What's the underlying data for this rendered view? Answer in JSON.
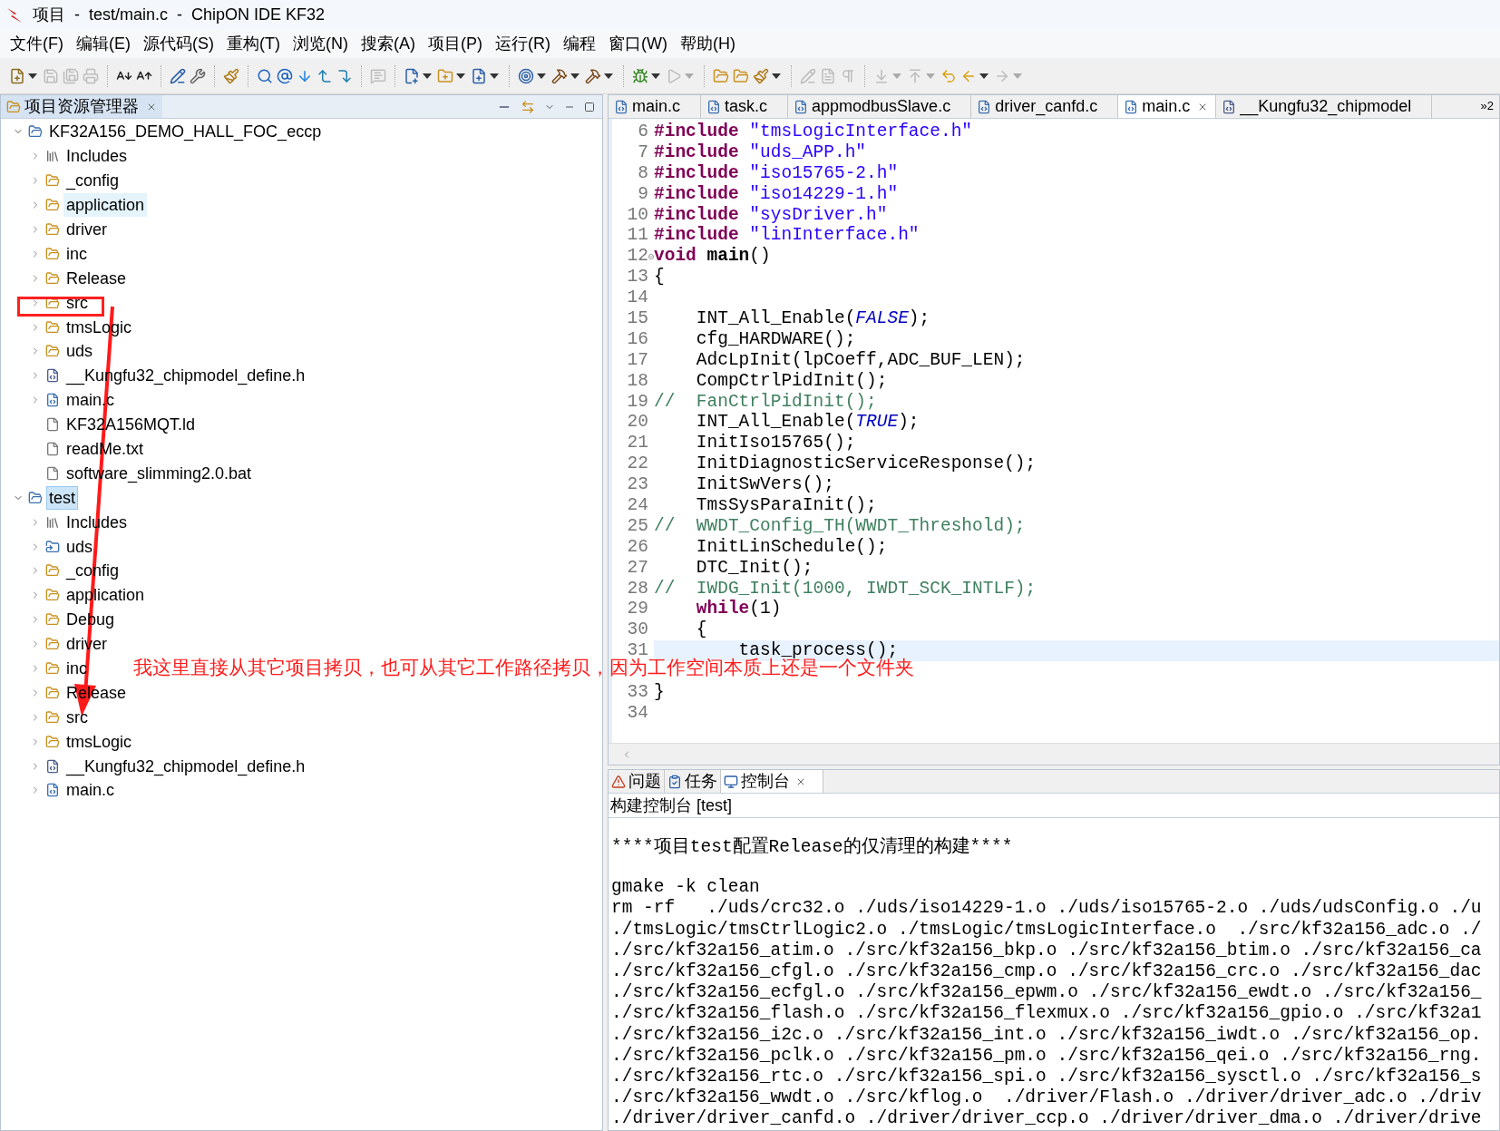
{
  "window": {
    "title": "项目  -  test/main.c  -  ChipON IDE KF32"
  },
  "menu": [
    "文件(F)",
    "编辑(E)",
    "源代码(S)",
    "重构(T)",
    "浏览(N)",
    "搜索(A)",
    "项目(P)",
    "运行(R)",
    "编程",
    "窗口(W)",
    "帮助(H)"
  ],
  "toolbar": [
    {
      "kind": "new",
      "disabled": false
    },
    {
      "kind": "caret",
      "disabled": false
    },
    {
      "kind": "save",
      "disabled": true
    },
    {
      "kind": "saveall",
      "disabled": true
    },
    {
      "kind": "print",
      "disabled": true
    },
    {
      "kind": "sep"
    },
    {
      "kind": "smaller",
      "disabled": false
    },
    {
      "kind": "larger",
      "disabled": false
    },
    {
      "kind": "sep"
    },
    {
      "kind": "pencil",
      "disabled": false
    },
    {
      "kind": "wrench",
      "disabled": false
    },
    {
      "kind": "sep"
    },
    {
      "kind": "brush",
      "disabled": false
    },
    {
      "kind": "sep"
    },
    {
      "kind": "search",
      "disabled": false
    },
    {
      "kind": "at",
      "disabled": false
    },
    {
      "kind": "down",
      "disabled": false
    },
    {
      "kind": "stepup",
      "disabled": false
    },
    {
      "kind": "stepdown",
      "disabled": false
    },
    {
      "kind": "sep"
    },
    {
      "kind": "comment",
      "disabled": true
    },
    {
      "kind": "sep"
    },
    {
      "kind": "newclass",
      "disabled": false
    },
    {
      "kind": "caret",
      "disabled": false
    },
    {
      "kind": "newfolder",
      "disabled": false
    },
    {
      "kind": "caret",
      "disabled": false
    },
    {
      "kind": "newfile",
      "disabled": false
    },
    {
      "kind": "caret",
      "disabled": false
    },
    {
      "kind": "sep"
    },
    {
      "kind": "target",
      "disabled": false
    },
    {
      "kind": "caret",
      "disabled": false
    },
    {
      "kind": "hammer",
      "disabled": false
    },
    {
      "kind": "caret",
      "disabled": false
    },
    {
      "kind": "hammer",
      "disabled": false
    },
    {
      "kind": "caret",
      "disabled": false
    },
    {
      "kind": "sep"
    },
    {
      "kind": "bug",
      "disabled": false
    },
    {
      "kind": "caret",
      "disabled": false
    },
    {
      "kind": "run",
      "disabled": true
    },
    {
      "kind": "caret",
      "disabled": true
    },
    {
      "kind": "sep"
    },
    {
      "kind": "open",
      "disabled": false
    },
    {
      "kind": "open",
      "disabled": false
    },
    {
      "kind": "brush",
      "disabled": false
    },
    {
      "kind": "caret",
      "disabled": false
    },
    {
      "kind": "sep"
    },
    {
      "kind": "pencil",
      "disabled": true
    },
    {
      "kind": "doc",
      "disabled": true
    },
    {
      "kind": "pilcrow",
      "disabled": true
    },
    {
      "kind": "sep"
    },
    {
      "kind": "nextann",
      "disabled": true
    },
    {
      "kind": "caret",
      "disabled": true
    },
    {
      "kind": "prevann",
      "disabled": true
    },
    {
      "kind": "caret",
      "disabled": true
    },
    {
      "kind": "lastedit",
      "disabled": false
    },
    {
      "kind": "back",
      "disabled": false
    },
    {
      "kind": "caret",
      "disabled": false
    },
    {
      "kind": "forward",
      "disabled": true
    },
    {
      "kind": "caret",
      "disabled": true
    }
  ],
  "explorer": {
    "title": "项目资源管理器",
    "tree": [
      {
        "label": "KF32A156_DEMO_HALL_FOC_eccp",
        "kind": "project",
        "expanded": true,
        "selected": false,
        "hovered": false,
        "children": [
          {
            "label": "Includes",
            "kind": "includes",
            "expanded": false,
            "selected": false,
            "hovered": false
          },
          {
            "label": "_config",
            "kind": "folder",
            "expanded": false,
            "selected": false,
            "hovered": false
          },
          {
            "label": "application",
            "kind": "folder",
            "expanded": false,
            "selected": false,
            "hovered": true
          },
          {
            "label": "driver",
            "kind": "folder",
            "expanded": false,
            "selected": false,
            "hovered": false
          },
          {
            "label": "inc",
            "kind": "folder",
            "expanded": false,
            "selected": false,
            "hovered": false
          },
          {
            "label": "Release",
            "kind": "folder",
            "expanded": false,
            "selected": false,
            "hovered": false
          },
          {
            "label": "src",
            "kind": "folder",
            "expanded": false,
            "selected": false,
            "hovered": false
          },
          {
            "label": "tmsLogic",
            "kind": "folder",
            "expanded": false,
            "selected": false,
            "hovered": false
          },
          {
            "label": "uds",
            "kind": "folder",
            "expanded": false,
            "selected": false,
            "hovered": false
          },
          {
            "label": "__Kungfu32_chipmodel_define.h",
            "kind": "header",
            "expanded": false,
            "selected": false,
            "hovered": false
          },
          {
            "label": "main.c",
            "kind": "cfile",
            "expanded": false,
            "selected": false,
            "hovered": false
          },
          {
            "label": "KF32A156MQT.ld",
            "kind": "file",
            "selected": false,
            "hovered": false
          },
          {
            "label": "readMe.txt",
            "kind": "file",
            "selected": false,
            "hovered": false
          },
          {
            "label": "software_slimming2.0.bat",
            "kind": "file",
            "selected": false,
            "hovered": false
          }
        ]
      },
      {
        "label": "test",
        "kind": "project",
        "expanded": true,
        "selected": true,
        "hovered": false,
        "children": [
          {
            "label": "Includes",
            "kind": "includes",
            "expanded": false,
            "selected": false,
            "hovered": false
          },
          {
            "label": "uds",
            "kind": "linkfolder",
            "expanded": false,
            "selected": false,
            "hovered": false
          },
          {
            "label": "_config",
            "kind": "folder",
            "expanded": false,
            "selected": false,
            "hovered": false
          },
          {
            "label": "application",
            "kind": "folder",
            "expanded": false,
            "selected": false,
            "hovered": false
          },
          {
            "label": "Debug",
            "kind": "folder",
            "expanded": false,
            "selected": false,
            "hovered": false
          },
          {
            "label": "driver",
            "kind": "folder",
            "expanded": false,
            "selected": false,
            "hovered": false
          },
          {
            "label": "inc",
            "kind": "folder",
            "expanded": false,
            "selected": false,
            "hovered": false
          },
          {
            "label": "Release",
            "kind": "folder",
            "expanded": false,
            "selected": false,
            "hovered": false
          },
          {
            "label": "src",
            "kind": "folder",
            "expanded": false,
            "selected": false,
            "hovered": false
          },
          {
            "label": "tmsLogic",
            "kind": "folder",
            "expanded": false,
            "selected": false,
            "hovered": false
          },
          {
            "label": "__Kungfu32_chipmodel_define.h",
            "kind": "header",
            "expanded": false,
            "selected": false,
            "hovered": false
          },
          {
            "label": "main.c",
            "kind": "cfile",
            "expanded": false,
            "selected": false,
            "hovered": false
          }
        ]
      }
    ]
  },
  "editor": {
    "tabs": [
      {
        "label": "main.c",
        "kind": "c",
        "selected": false
      },
      {
        "label": "task.c",
        "kind": "c",
        "selected": false
      },
      {
        "label": "appmodbusSlave.c",
        "kind": "c",
        "selected": false
      },
      {
        "label": "driver_canfd.c",
        "kind": "c",
        "selected": false
      },
      {
        "label": "main.c",
        "kind": "c",
        "selected": true
      },
      {
        "label": "__Kungfu32_chipmodel",
        "kind": "h",
        "selected": false
      }
    ],
    "overflow": "»2",
    "lines": [
      {
        "num": "6",
        "kind": "code",
        "parts": [
          {
            "kind": "keyword",
            "text": "#include"
          },
          {
            "kind": "string",
            "text": " \"tmsLogicInterface.h\""
          }
        ]
      },
      {
        "num": "7",
        "kind": "code",
        "parts": [
          {
            "kind": "keyword",
            "text": "#include"
          },
          {
            "kind": "string",
            "text": " \"uds_APP.h\""
          }
        ]
      },
      {
        "num": "8",
        "kind": "code",
        "parts": [
          {
            "kind": "keyword",
            "text": "#include"
          },
          {
            "kind": "string",
            "text": " \"iso15765-2.h\""
          }
        ]
      },
      {
        "num": "9",
        "kind": "code",
        "parts": [
          {
            "kind": "keyword",
            "text": "#include"
          },
          {
            "kind": "string",
            "text": " \"iso14229-1.h\""
          }
        ]
      },
      {
        "num": "10",
        "kind": "code",
        "parts": [
          {
            "kind": "keyword",
            "text": "#include"
          },
          {
            "kind": "string",
            "text": " \"sysDriver.h\""
          }
        ]
      },
      {
        "num": "11",
        "kind": "code",
        "parts": [
          {
            "kind": "keyword",
            "text": "#include"
          },
          {
            "kind": "string",
            "text": " \"linInterface.h\""
          }
        ]
      },
      {
        "num": "12",
        "kind": "fold",
        "parts": [
          {
            "kind": "keyword",
            "text": "void"
          },
          {
            "kind": "name",
            "text": " main"
          },
          {
            "kind": "plain",
            "text": "()"
          }
        ]
      },
      {
        "num": "13",
        "kind": "code",
        "parts": [
          {
            "kind": "plain",
            "text": "{"
          }
        ]
      },
      {
        "num": "14",
        "kind": "code"
      },
      {
        "num": "15",
        "kind": "code",
        "parts": [
          {
            "kind": "plain",
            "text": "    INT_All_Enable("
          },
          {
            "kind": "constant",
            "text": "FALSE"
          },
          {
            "kind": "plain",
            "text": ");"
          }
        ]
      },
      {
        "num": "16",
        "kind": "code",
        "parts": [
          {
            "kind": "plain",
            "text": "    cfg_HARDWARE();"
          }
        ]
      },
      {
        "num": "17",
        "kind": "code",
        "parts": [
          {
            "kind": "plain",
            "text": "    AdcLpInit(lpCoeff,ADC_BUF_LEN);"
          }
        ]
      },
      {
        "num": "18",
        "kind": "code",
        "parts": [
          {
            "kind": "plain",
            "text": "    CompCtrlPidInit();"
          }
        ]
      },
      {
        "num": "19",
        "kind": "code",
        "parts": [
          {
            "kind": "comment",
            "text": "//  FanCtrlPidInit();"
          }
        ]
      },
      {
        "num": "20",
        "kind": "code",
        "parts": [
          {
            "kind": "plain",
            "text": "    INT_All_Enable("
          },
          {
            "kind": "constant",
            "text": "TRUE"
          },
          {
            "kind": "plain",
            "text": ");"
          }
        ]
      },
      {
        "num": "21",
        "kind": "code",
        "parts": [
          {
            "kind": "plain",
            "text": "    InitIso15765();"
          }
        ]
      },
      {
        "num": "22",
        "kind": "code",
        "parts": [
          {
            "kind": "plain",
            "text": "    InitDiagnosticServiceResponse();"
          }
        ]
      },
      {
        "num": "23",
        "kind": "code",
        "parts": [
          {
            "kind": "plain",
            "text": "    InitSwVers();"
          }
        ]
      },
      {
        "num": "24",
        "kind": "code",
        "parts": [
          {
            "kind": "plain",
            "text": "    TmsSysParaInit();"
          }
        ]
      },
      {
        "num": "25",
        "kind": "code",
        "parts": [
          {
            "kind": "comment",
            "text": "//  WWDT_Config_TH(WWDT_Threshold);"
          }
        ]
      },
      {
        "num": "26",
        "kind": "code",
        "parts": [
          {
            "kind": "plain",
            "text": "    InitLinSchedule();"
          }
        ]
      },
      {
        "num": "27",
        "kind": "code",
        "parts": [
          {
            "kind": "plain",
            "text": "    DTC_Init();"
          }
        ]
      },
      {
        "num": "28",
        "kind": "code",
        "parts": [
          {
            "kind": "comment",
            "text": "//  IWDG_Init(1000, IWDT_SCK_INTLF);"
          }
        ]
      },
      {
        "num": "29",
        "kind": "code",
        "parts": [
          {
            "kind": "keyword",
            "text": "    while"
          },
          {
            "kind": "plain",
            "text": "(1)"
          }
        ]
      },
      {
        "num": "30",
        "kind": "code",
        "parts": [
          {
            "kind": "plain",
            "text": "    {"
          }
        ]
      },
      {
        "num": "31",
        "kind": "current",
        "parts": [
          {
            "kind": "plain",
            "text": "        task_process();"
          }
        ]
      },
      {
        "kind": "covered"
      },
      {
        "num": "33",
        "kind": "code",
        "parts": [
          {
            "kind": "plain",
            "text": "}"
          }
        ]
      },
      {
        "num": "34",
        "kind": "code"
      }
    ]
  },
  "bottom": {
    "tabs": [
      {
        "label": "问题",
        "kind": "problems",
        "selected": false,
        "closable": false
      },
      {
        "label": "任务",
        "kind": "tasks",
        "selected": false,
        "closable": false
      },
      {
        "label": "控制台",
        "kind": "console",
        "selected": true,
        "closable": true
      }
    ],
    "console_title": "构建控制台 [test]",
    "blocks": [
      [
        "****项目test配置Release的仅清理的构建****"
      ],
      [
        "gmake -k clean",
        "rm -rf   ./uds/crc32.o ./uds/iso14229-1.o ./uds/iso15765-2.o ./uds/udsConfig.o ./u",
        "./tmsLogic/tmsCtrlLogic2.o ./tmsLogic/tmsLogicInterface.o  ./src/kf32a156_adc.o ./",
        "./src/kf32a156_atim.o ./src/kf32a156_bkp.o ./src/kf32a156_btim.o ./src/kf32a156_ca",
        "./src/kf32a156_cfgl.o ./src/kf32a156_cmp.o ./src/kf32a156_crc.o ./src/kf32a156_dac",
        "./src/kf32a156_ecfgl.o ./src/kf32a156_epwm.o ./src/kf32a156_ewdt.o ./src/kf32a156_",
        "./src/kf32a156_flash.o ./src/kf32a156_flexmux.o ./src/kf32a156_gpio.o ./src/kf32a1",
        "./src/kf32a156_i2c.o ./src/kf32a156_int.o ./src/kf32a156_iwdt.o ./src/kf32a156_op.",
        "./src/kf32a156_pclk.o ./src/kf32a156_pm.o ./src/kf32a156_qei.o ./src/kf32a156_rng.",
        "./src/kf32a156_rtc.o ./src/kf32a156_spi.o ./src/kf32a156_sysctl.o ./src/kf32a156_s",
        "./src/kf32a156_wwdt.o ./src/kflog.o  ./driver/Flash.o ./driver/driver_adc.o ./driv",
        "./driver/driver_canfd.o ./driver/driver_ccp.o ./driver/driver_dma.o ./driver/drive"
      ]
    ]
  },
  "annotation": {
    "text": "我这里直接从其它项目拷贝，也可从其它工作路径拷贝，因为工作空间本质上还是一个文件夹"
  }
}
